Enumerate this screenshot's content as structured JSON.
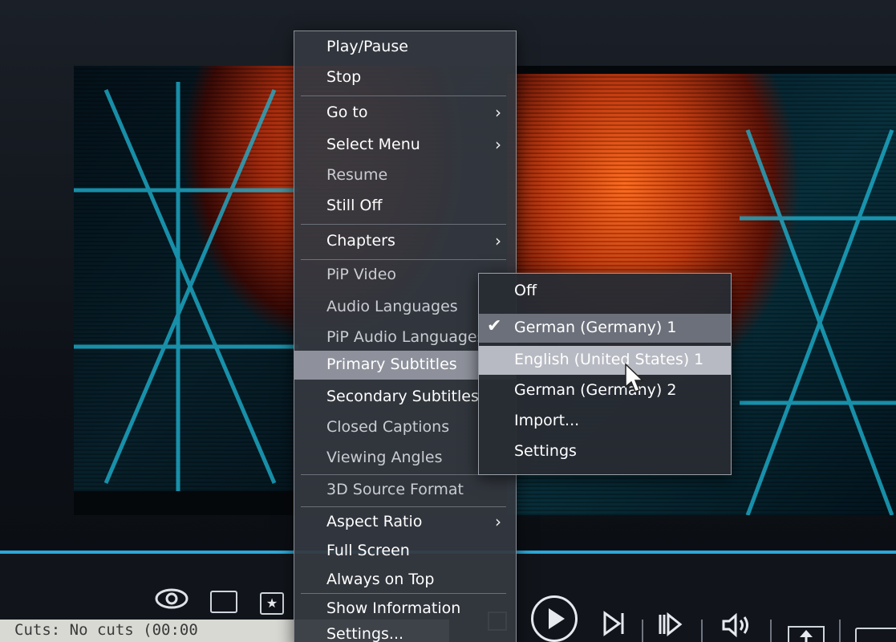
{
  "context_menu": {
    "items": [
      {
        "label": "Play/Pause",
        "state": "normal"
      },
      {
        "label": "Stop",
        "state": "normal"
      },
      {
        "label": "Go to",
        "state": "normal",
        "submenu": true
      },
      {
        "label": "Select Menu",
        "state": "normal",
        "submenu": true
      },
      {
        "label": "Resume",
        "state": "disabled"
      },
      {
        "label": "Still Off",
        "state": "normal"
      },
      {
        "label": "Chapters",
        "state": "normal",
        "submenu": true
      },
      {
        "label": "PiP Video",
        "state": "disabled"
      },
      {
        "label": "Audio Languages",
        "state": "disabled"
      },
      {
        "label": "PiP Audio Languages",
        "state": "disabled"
      },
      {
        "label": "Primary Subtitles",
        "state": "highlighted"
      },
      {
        "label": "Secondary Subtitles",
        "state": "normal"
      },
      {
        "label": "Closed Captions",
        "state": "disabled"
      },
      {
        "label": "Viewing Angles",
        "state": "disabled"
      },
      {
        "label": "3D Source Format",
        "state": "disabled"
      },
      {
        "label": "Aspect Ratio",
        "state": "normal",
        "submenu": true
      },
      {
        "label": "Full Screen",
        "state": "normal"
      },
      {
        "label": "Always on Top",
        "state": "normal"
      },
      {
        "label": "Show Information",
        "state": "normal"
      },
      {
        "label": "Settings...",
        "state": "normal"
      }
    ],
    "submenu_arrow": "›"
  },
  "subtitles_submenu": {
    "items": [
      {
        "label": "Off",
        "checked": false
      },
      {
        "label": "German (Germany) 1",
        "checked": true
      },
      {
        "label": "English (United States) 1",
        "checked": false,
        "hover": true
      },
      {
        "label": "German (Germany) 2",
        "checked": false
      },
      {
        "label": "Import...",
        "checked": false
      },
      {
        "label": "Settings",
        "checked": false
      }
    ],
    "check_glyph": "✔"
  },
  "toolbar": {
    "icons": [
      "eye-icon",
      "contact-card-icon",
      "bookmark-star-icon",
      "stop-square-icon",
      "play-icon",
      "next-track-icon",
      "frame-step-icon",
      "volume-icon",
      "eject-icon",
      "window-box-icon"
    ],
    "star_glyph": "★"
  },
  "status_bar": {
    "text": "Cuts: No cuts (00:00"
  },
  "colors": {
    "accent_seek": "#2aa8d8",
    "menu_bg": "#343840",
    "highlight": "#8e919b"
  }
}
